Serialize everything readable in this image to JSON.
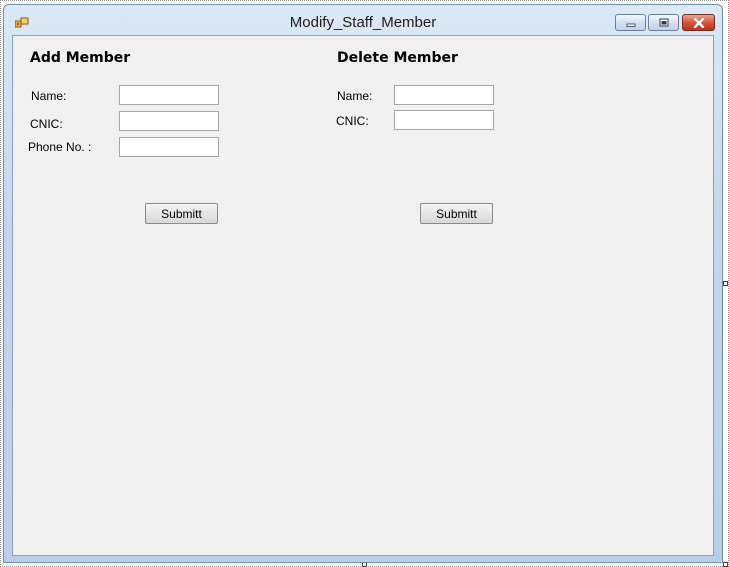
{
  "window": {
    "title": "Modify_Staff_Member",
    "controls": {
      "minimize_icon": "minimize-icon",
      "maximize_icon": "maximize-icon",
      "close_icon": "close-icon"
    }
  },
  "add_member": {
    "heading": "Add Member",
    "name_label": "Name:",
    "name_value": "",
    "cnic_label": "CNIC:",
    "cnic_value": "",
    "phone_label": "Phone No. :",
    "phone_value": "",
    "submit_label": "Submitt"
  },
  "delete_member": {
    "heading": "Delete Member",
    "name_label": "Name:",
    "name_value": "",
    "cnic_label": "CNIC:",
    "cnic_value": "",
    "submit_label": "Submitt"
  },
  "colors": {
    "form_background": "#f0f0f0",
    "title_bar": "#c2d6ec",
    "close_button": "#c1321a"
  }
}
